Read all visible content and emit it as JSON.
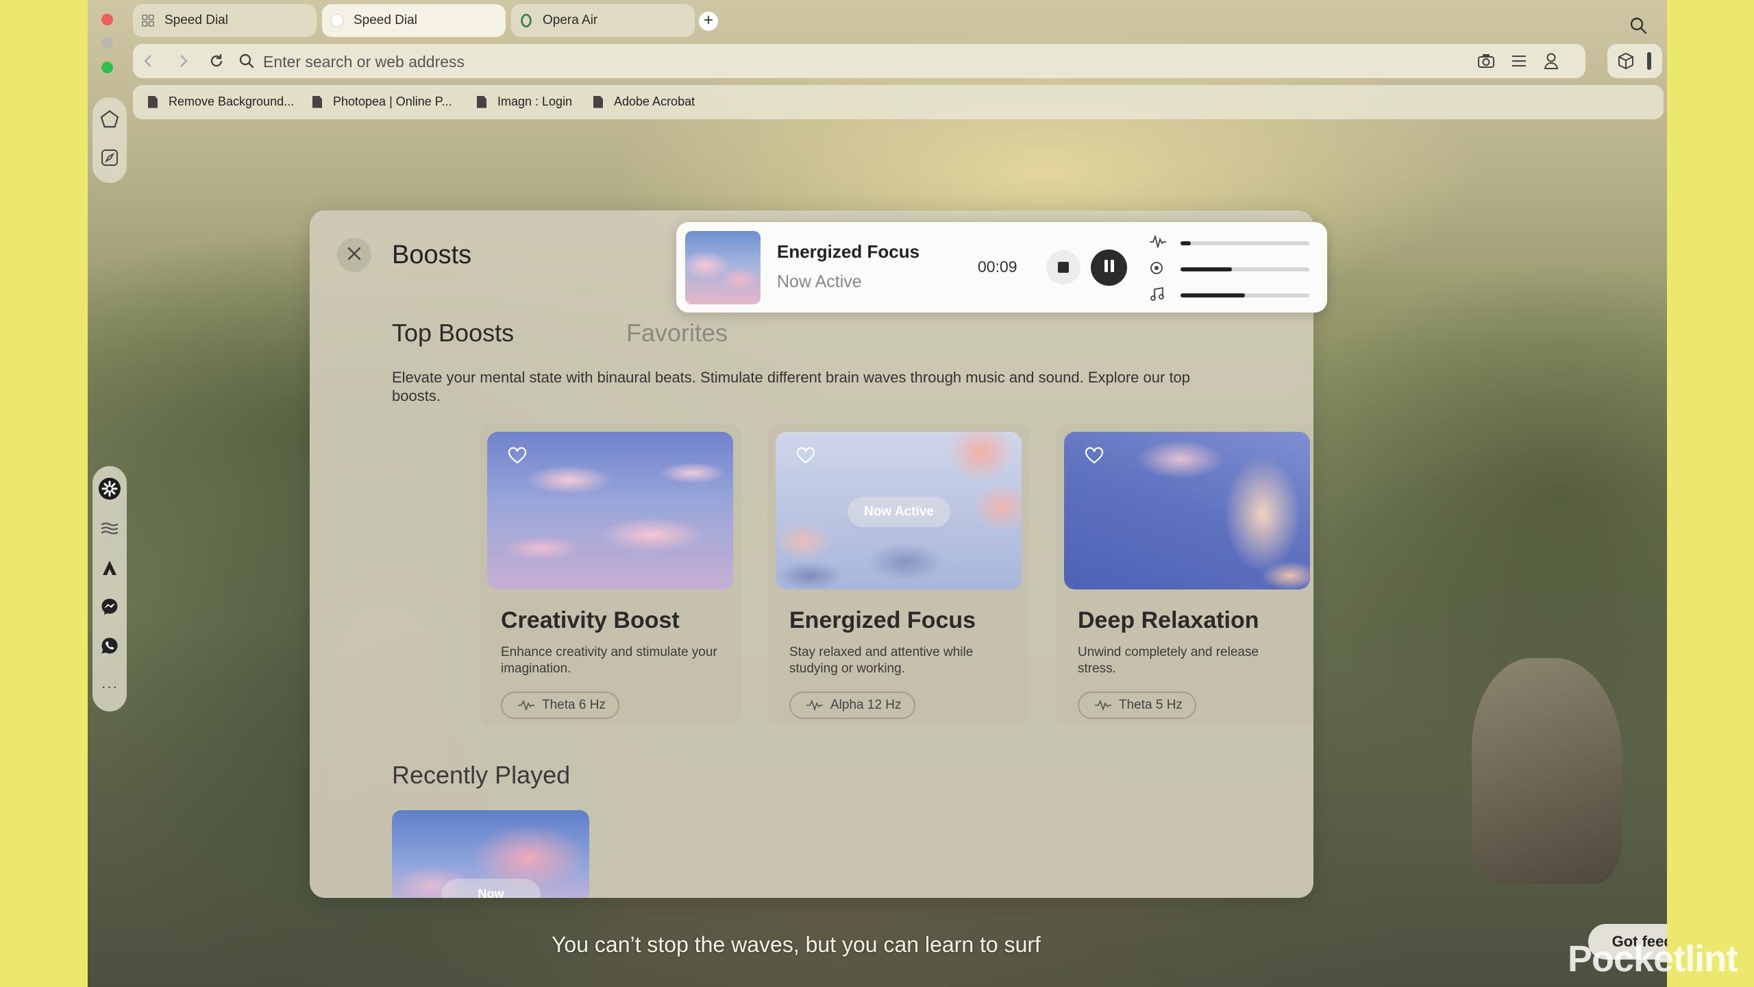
{
  "browser": {
    "tabs": [
      {
        "label": "Speed Dial",
        "icon": "grid-icon",
        "active": false
      },
      {
        "label": "Speed Dial",
        "icon": "opera-circle-icon",
        "active": true
      },
      {
        "label": "Opera Air",
        "icon": "opera-o-icon",
        "active": false
      }
    ],
    "address_placeholder": "Enter search or web address",
    "bookmarks": [
      "Remove Background...",
      "Photopea | Online P...",
      "Imagn : Login",
      "Adobe Acrobat"
    ],
    "traffic_lights": {
      "close": "#ec5f58",
      "minimize": "#bdbab0",
      "zoom": "#2fbf4a"
    }
  },
  "modal": {
    "title": "Boosts",
    "tabs": {
      "top": "Top Boosts",
      "favorites": "Favorites"
    },
    "intro": "Elevate your mental state with binaural beats. Stimulate different brain waves through music and sound. Explore our top boosts.",
    "cards": [
      {
        "title": "Creativity Boost",
        "desc": "Enhance creativity and stimulate your imagination.",
        "chip": "Theta 6 Hz",
        "now_active": ""
      },
      {
        "title": "Energized Focus",
        "desc": "Stay relaxed and attentive while studying or working.",
        "chip": "Alpha 12 Hz",
        "now_active": "Now Active"
      },
      {
        "title": "Deep Relaxation",
        "desc": "Unwind completely and release stress.",
        "chip": "Theta 5 Hz",
        "now_active": ""
      }
    ],
    "recently_played": {
      "title": "Recently Played",
      "pill": "Now"
    }
  },
  "player": {
    "title": "Energized Focus",
    "status": "Now Active",
    "time": "00:09",
    "mix": [
      {
        "icon": "waveform-icon",
        "level": 0.08
      },
      {
        "icon": "target-icon",
        "level": 0.4
      },
      {
        "icon": "music-note-icon",
        "level": 0.5
      }
    ]
  },
  "footer": {
    "quote": "You can’t stop the waves, but you can learn to surf",
    "feedback": "Got feedback?",
    "watermark": "Pocketlint"
  }
}
